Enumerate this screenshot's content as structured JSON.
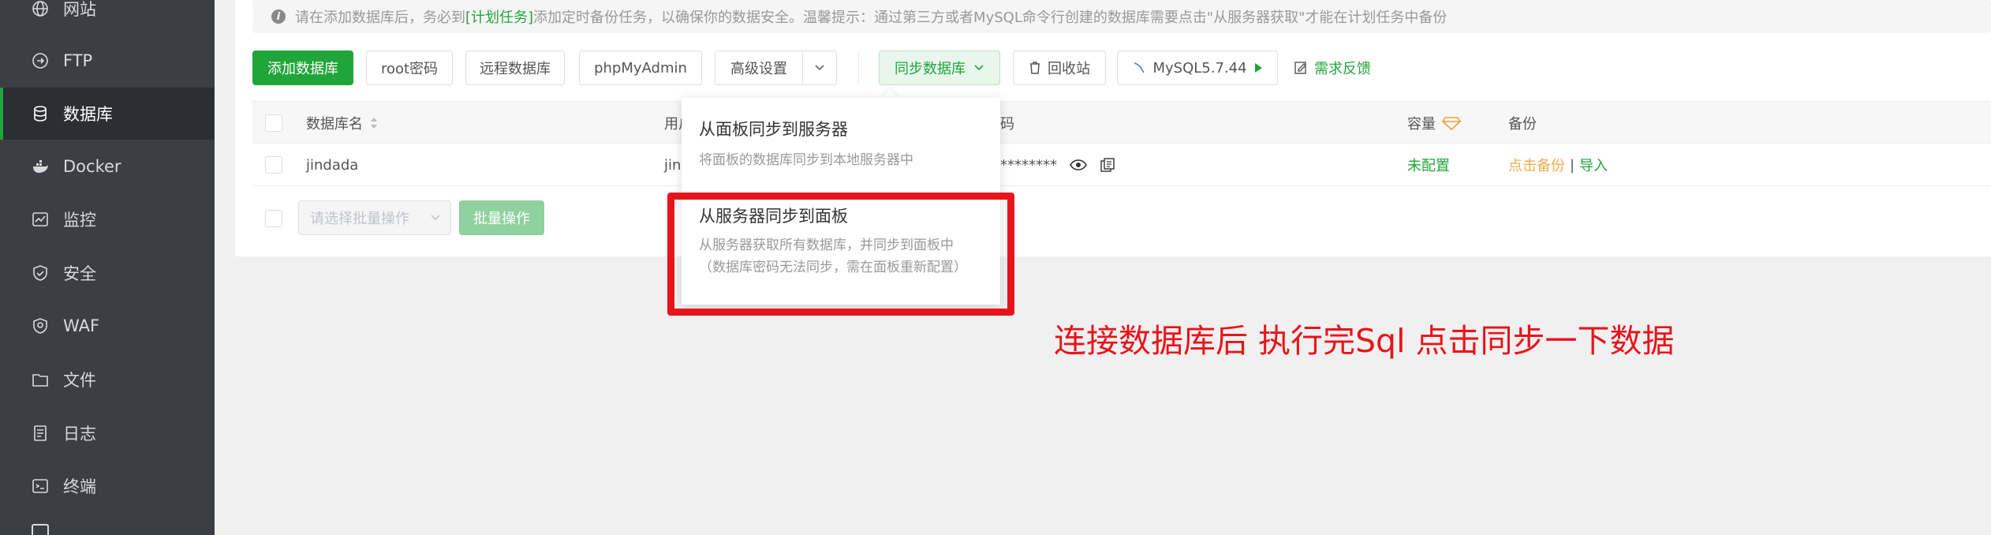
{
  "sidebar": {
    "items": [
      {
        "label": "网站",
        "icon": "globe-icon"
      },
      {
        "label": "FTP",
        "icon": "ftp-icon"
      },
      {
        "label": "数据库",
        "icon": "database-icon",
        "active": true
      },
      {
        "label": "Docker",
        "icon": "docker-icon"
      },
      {
        "label": "监控",
        "icon": "monitor-icon"
      },
      {
        "label": "安全",
        "icon": "shield-icon"
      },
      {
        "label": "WAF",
        "icon": "waf-icon"
      },
      {
        "label": "文件",
        "icon": "folder-icon"
      },
      {
        "label": "日志",
        "icon": "log-icon"
      },
      {
        "label": "终端",
        "icon": "terminal-icon"
      }
    ]
  },
  "notice": {
    "prefix": "请在添加数据库后，务必到",
    "link": "[计划任务]",
    "suffix": "添加定时备份任务，以确保你的数据安全。温馨提示：通过第三方或者MySQL命令行创建的数据库需要点击\"从服务器获取\"才能在计划任务中备份"
  },
  "toolbar": {
    "add": "添加数据库",
    "root_password": "root密码",
    "remote": "远程数据库",
    "phpmyadmin": "phpMyAdmin",
    "advanced": "高级设置",
    "sync": "同步数据库",
    "recycle": "回收站",
    "mysql_version": "MySQL5.7.44",
    "feedback": "需求反馈"
  },
  "table": {
    "headers": {
      "name": "数据库名",
      "user": "用户",
      "password": "码",
      "capacity": "容量",
      "backup": "备份"
    },
    "rows": [
      {
        "name": "jindada",
        "user": "jin",
        "password": "********",
        "capacity": "未配置",
        "backup": "点击备份",
        "sep": "|",
        "import": "导入"
      }
    ],
    "batch_placeholder": "请选择批量操作",
    "batch_button": "批量操作"
  },
  "sync_menu": {
    "item1_title": "从面板同步到服务器",
    "item1_desc": "将面板的数据库同步到本地服务器中",
    "item2_title": "从服务器同步到面板",
    "item2_desc1": "从服务器获取所有数据库，并同步到面板中",
    "item2_desc2": "（数据库密码无法同步，需在面板重新配置）"
  },
  "annotation": "连接数据库后 执行完Sql 点击同步一下数据",
  "colors": {
    "accent": "#20a53a",
    "sidebar": "#3b3f45",
    "highlight": "#e8141b",
    "warning": "#f0ad4e"
  }
}
